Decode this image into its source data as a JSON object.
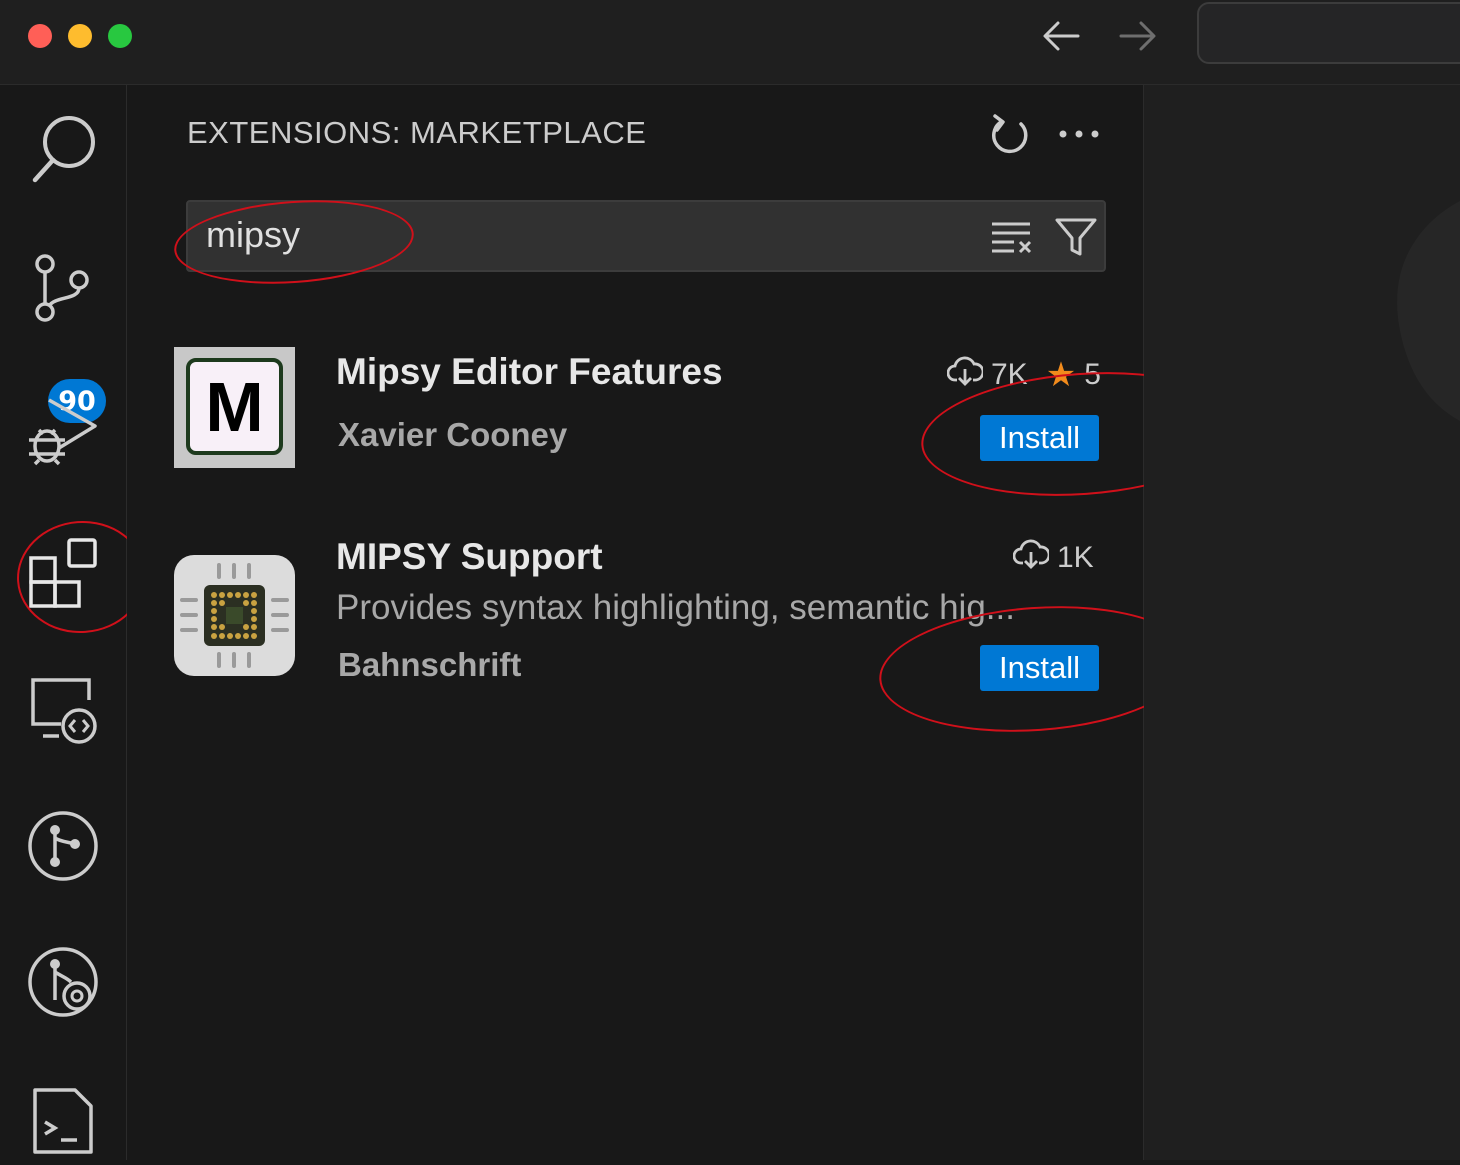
{
  "window": {
    "traffic_lights": [
      {
        "name": "close",
        "color": "#ff5f57"
      },
      {
        "name": "minimize",
        "color": "#febc2e"
      },
      {
        "name": "maximize",
        "color": "#28c840"
      }
    ]
  },
  "navigation": {
    "back_icon": "arrow-left-icon",
    "forward_icon": "arrow-right-icon"
  },
  "activity_bar": {
    "items": [
      {
        "name": "search",
        "icon": "search-icon"
      },
      {
        "name": "source-control",
        "icon": "source-control-icon",
        "badge": "90"
      },
      {
        "name": "run-and-debug",
        "icon": "run-debug-icon"
      },
      {
        "name": "extensions",
        "icon": "extensions-icon"
      },
      {
        "name": "remote-explorer",
        "icon": "remote-explorer-icon"
      },
      {
        "name": "git-graph",
        "icon": "git-graph-icon"
      },
      {
        "name": "git-lens",
        "icon": "git-lens-icon"
      },
      {
        "name": "terminal",
        "icon": "terminal-icon"
      }
    ]
  },
  "sidebar": {
    "title": "EXTENSIONS: MARKETPLACE",
    "actions": [
      {
        "name": "refresh",
        "icon": "refresh-icon"
      },
      {
        "name": "more-actions",
        "icon": "ellipsis-icon"
      }
    ],
    "search": {
      "value": "mipsy",
      "clear_icon": "clear-filter-icon",
      "filter_icon": "filter-icon"
    },
    "extensions": [
      {
        "name": "Mipsy Editor Features",
        "publisher": "Xavier Cooney",
        "description": "",
        "downloads": "7K",
        "rating": "5",
        "install_label": "Install",
        "icon_letter": "M"
      },
      {
        "name": "MIPSY Support",
        "publisher": "Bahnschrift",
        "description": "Provides syntax highlighting, semantic hig...",
        "downloads": "1K",
        "install_label": "Install"
      }
    ]
  },
  "editor": {
    "watermark": "cod"
  },
  "colors": {
    "accent": "#0078d4",
    "annotation": "#d0101a",
    "star": "#f28b1c",
    "background": "#181818"
  }
}
